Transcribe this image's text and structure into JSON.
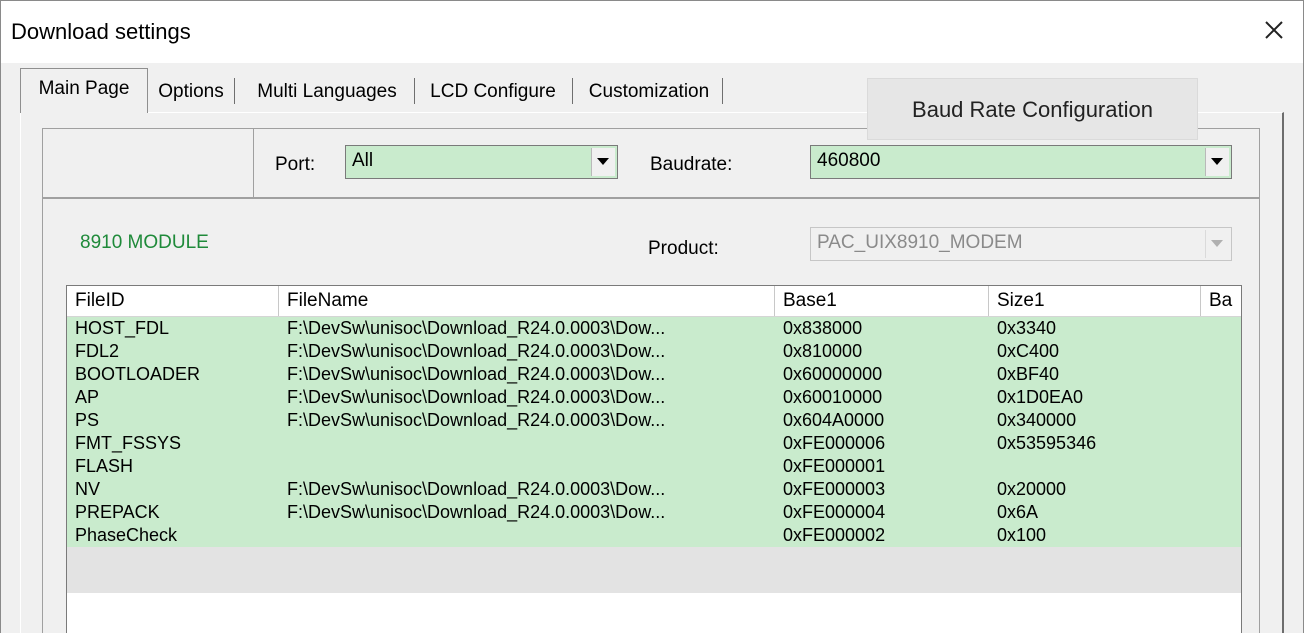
{
  "window": {
    "title": "Download settings"
  },
  "tabs": [
    {
      "label": "Main Page",
      "active": true
    },
    {
      "label": "Options",
      "active": false
    },
    {
      "label": "Multi Languages",
      "active": false
    },
    {
      "label": "LCD Configure",
      "active": false
    },
    {
      "label": "Customization",
      "active": false
    }
  ],
  "tooltip": {
    "text": "Baud Rate Configuration"
  },
  "port": {
    "label": "Port:",
    "value": "All"
  },
  "baudrate": {
    "label": "Baudrate:",
    "value": "460800"
  },
  "module": {
    "name": "8910 MODULE"
  },
  "product": {
    "label": "Product:",
    "value": "PAC_UIX8910_MODEM"
  },
  "table": {
    "columns": [
      "FileID",
      "FileName",
      "Base1",
      "Size1",
      "Ba"
    ],
    "rows": [
      [
        "HOST_FDL",
        "F:\\DevSw\\unisoc\\Download_R24.0.0003\\Dow...",
        "0x838000",
        "0x3340"
      ],
      [
        "FDL2",
        "F:\\DevSw\\unisoc\\Download_R24.0.0003\\Dow...",
        "0x810000",
        "0xC400"
      ],
      [
        "BOOTLOADER",
        "F:\\DevSw\\unisoc\\Download_R24.0.0003\\Dow...",
        "0x60000000",
        "0xBF40"
      ],
      [
        "AP",
        "F:\\DevSw\\unisoc\\Download_R24.0.0003\\Dow...",
        "0x60010000",
        "0x1D0EA0"
      ],
      [
        "PS",
        "F:\\DevSw\\unisoc\\Download_R24.0.0003\\Dow...",
        "0x604A0000",
        "0x340000"
      ],
      [
        "FMT_FSSYS",
        "",
        "0xFE000006",
        "0x53595346"
      ],
      [
        "FLASH",
        "",
        "0xFE000001",
        ""
      ],
      [
        "NV",
        "F:\\DevSw\\unisoc\\Download_R24.0.0003\\Dow...",
        "0xFE000003",
        "0x20000"
      ],
      [
        "PREPACK",
        "F:\\DevSw\\unisoc\\Download_R24.0.0003\\Dow...",
        "0xFE000004",
        "0x6A"
      ],
      [
        "PhaseCheck",
        "",
        "0xFE000002",
        "0x100"
      ]
    ]
  },
  "colors": {
    "row_bg": "#c9ebcd",
    "module_text": "#1f8a3a"
  },
  "icons": {
    "close": "close-icon",
    "dropdown": "chevron-down-icon"
  }
}
